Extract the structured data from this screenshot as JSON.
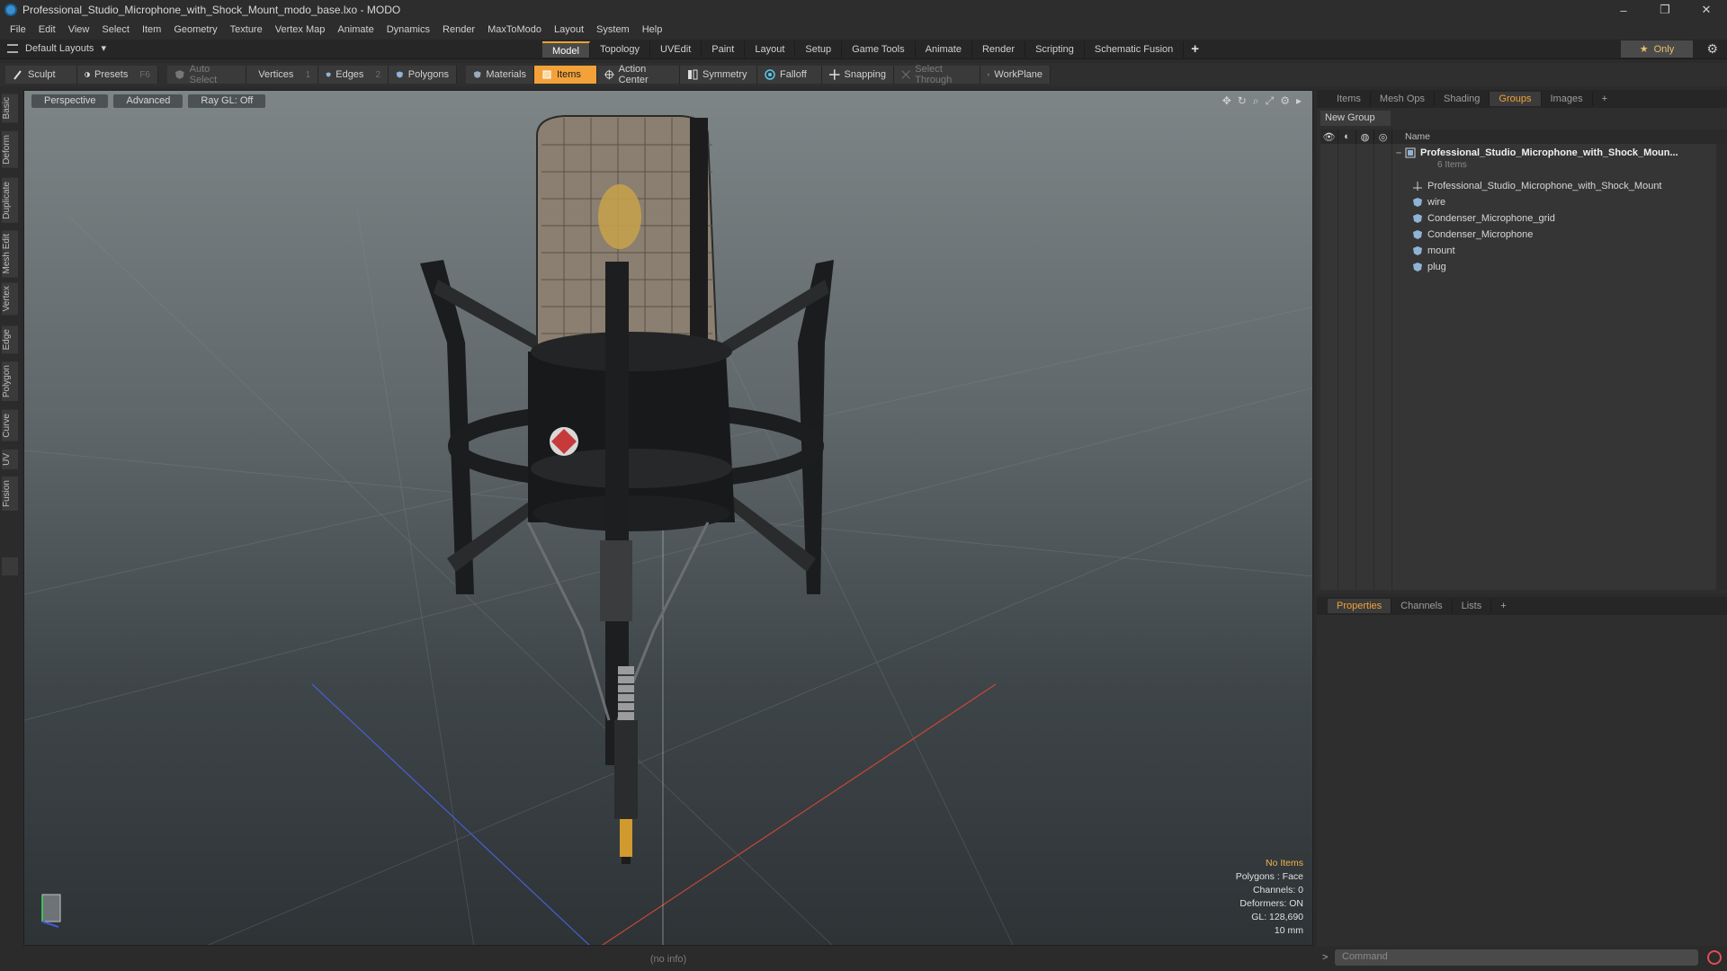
{
  "window": {
    "title": "Professional_Studio_Microphone_with_Shock_Mount_modo_base.lxo - MODO",
    "controls": [
      "–",
      "❐",
      "✕"
    ]
  },
  "menu": [
    "File",
    "Edit",
    "View",
    "Select",
    "Item",
    "Geometry",
    "Texture",
    "Vertex Map",
    "Animate",
    "Dynamics",
    "Render",
    "MaxToModo",
    "Layout",
    "System",
    "Help"
  ],
  "layout_bar": {
    "selector": "Default Layouts",
    "tabs": [
      "Model",
      "Topology",
      "UVEdit",
      "Paint",
      "Layout",
      "Setup",
      "Game Tools",
      "Animate",
      "Render",
      "Scripting",
      "Schematic Fusion"
    ],
    "active_tab": "Model",
    "plus": "+",
    "only_label": "Only",
    "only_star": "★"
  },
  "toolbar": {
    "sculpt": "Sculpt",
    "presets": "Presets",
    "presets_key": "F6",
    "auto_select": "Auto Select",
    "vertices": "Vertices",
    "vertices_count": "1",
    "edges": "Edges",
    "edges_count": "2",
    "polygons": "Polygons",
    "materials": "Materials",
    "items": "Items",
    "action_center": "Action Center",
    "symmetry": "Symmetry",
    "falloff": "Falloff",
    "snapping": "Snapping",
    "select_through": "Select Through",
    "workplane": "WorkPlane"
  },
  "left_tabs": [
    "Basic",
    "Deform",
    "Duplicate",
    "Mesh Edit",
    "Vertex",
    "Edge",
    "Polygon",
    "Curve",
    "UV",
    "Fusion"
  ],
  "viewport": {
    "view_mode": "Perspective",
    "shading": "Advanced",
    "raygl": "Ray GL: Off",
    "hud": {
      "selection": "No Items",
      "polygons": "Polygons : Face",
      "channels": "Channels: 0",
      "deformers": "Deformers: ON",
      "gl": "GL: 128,690",
      "unit": "10 mm"
    }
  },
  "status": "(no info)",
  "groups_panel": {
    "tabs": [
      "Items",
      "Mesh Ops",
      "Shading",
      "Groups",
      "Images"
    ],
    "active_tab": "Groups",
    "new_group": "New Group",
    "name_header": "Name",
    "group_name": "Professional_Studio_Microphone_with_Shock_Moun...",
    "group_count": "6 Items",
    "items": [
      "Professional_Studio_Microphone_with_Shock_Mount",
      "wire",
      "Condenser_Microphone_grid",
      "Condenser_Microphone",
      "mount",
      "plug"
    ]
  },
  "properties_panel": {
    "tabs": [
      "Properties",
      "Channels",
      "Lists"
    ],
    "active_tab": "Properties"
  },
  "command": {
    "prompt": ">",
    "placeholder": "Command"
  },
  "colors": {
    "accent": "#f3a23a",
    "hud_highlight": "#f0b44c"
  }
}
